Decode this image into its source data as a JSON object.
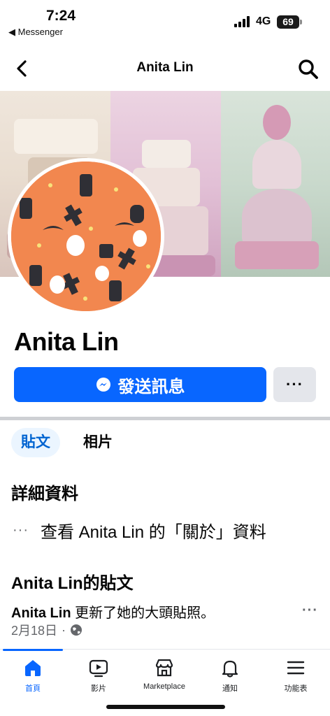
{
  "status_bar": {
    "time": "7:24",
    "back_app": "◀ Messenger",
    "network": "4G",
    "battery": "69"
  },
  "header": {
    "title": "Anita Lin"
  },
  "profile": {
    "name": "Anita Lin"
  },
  "actions": {
    "message_label": "發送訊息",
    "more_label": "···"
  },
  "tabs": [
    {
      "label": "貼文",
      "active": true
    },
    {
      "label": "相片",
      "active": false
    }
  ],
  "details": {
    "title": "詳細資料",
    "more_dots": "···",
    "about_link": "查看 Anita Lin 的「關於」資料"
  },
  "posts": {
    "title": "Anita Lin的貼文",
    "first_post": {
      "author": "Anita Lin",
      "action": " 更新了她的大頭貼照。",
      "date": "2月18日",
      "separator": "·",
      "more": "···"
    }
  },
  "bottom_nav": [
    {
      "label": "首頁",
      "icon": "home-icon",
      "active": true
    },
    {
      "label": "影片",
      "icon": "video-icon",
      "active": false
    },
    {
      "label": "Marketplace",
      "icon": "marketplace-icon",
      "active": false
    },
    {
      "label": "通知",
      "icon": "bell-icon",
      "active": false
    },
    {
      "label": "功能表",
      "icon": "menu-icon",
      "active": false
    }
  ],
  "colors": {
    "accent": "#0866ff",
    "tab_bg": "#ebf5ff",
    "avatar_bg": "#f2874f"
  }
}
